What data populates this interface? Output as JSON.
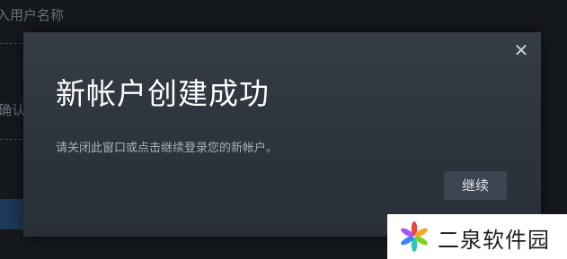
{
  "background": {
    "label_top": "入用户名称",
    "label_middle": "确认"
  },
  "dialog": {
    "title": "新帐户创建成功",
    "message": "请关闭此窗口或点击继续登录您的新帐户。",
    "continue_label": "继续",
    "close_glyph": "✕"
  },
  "watermark": {
    "text": "二泉软件园",
    "logo_colors": [
      "#e8453c",
      "#f5a623",
      "#7ed321",
      "#2ec4b6",
      "#3b82f6",
      "#a855f7"
    ]
  }
}
